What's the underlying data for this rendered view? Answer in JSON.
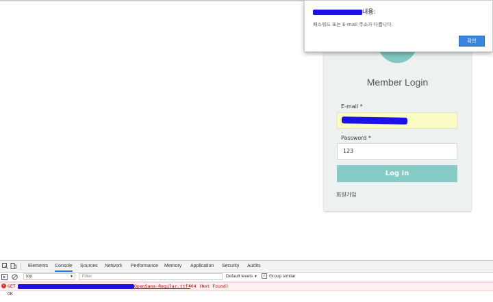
{
  "alert": {
    "title_suffix": "내용:",
    "message": "패스워드 또는 E-mail 주소가 다릅니다.",
    "ok_label": "확인"
  },
  "login": {
    "title": "Member Login",
    "email_label": "E-mail",
    "password_label": "Password",
    "required_mark": "*",
    "password_value": "123",
    "login_button": "Log in",
    "signup_link": "회원가입"
  },
  "devtools": {
    "tabs": [
      "Elements",
      "Console",
      "Sources",
      "Network",
      "Performance",
      "Memory",
      "Application",
      "Security",
      "Audits"
    ],
    "active_tab": "Console",
    "context": "top",
    "filter_placeholder": "Filter",
    "levels_label": "Default levels",
    "group_similar_label": "Group similar",
    "error_method": "GET",
    "error_file": "OpenSans-Regular.ttf'",
    "error_status": "404 (Not Found)",
    "ok_line": "OK"
  },
  "colors": {
    "accent": "#86cbc5",
    "avatar": "#7fc7bf",
    "alert_button": "#3b86e0",
    "error_text": "#c40000"
  }
}
